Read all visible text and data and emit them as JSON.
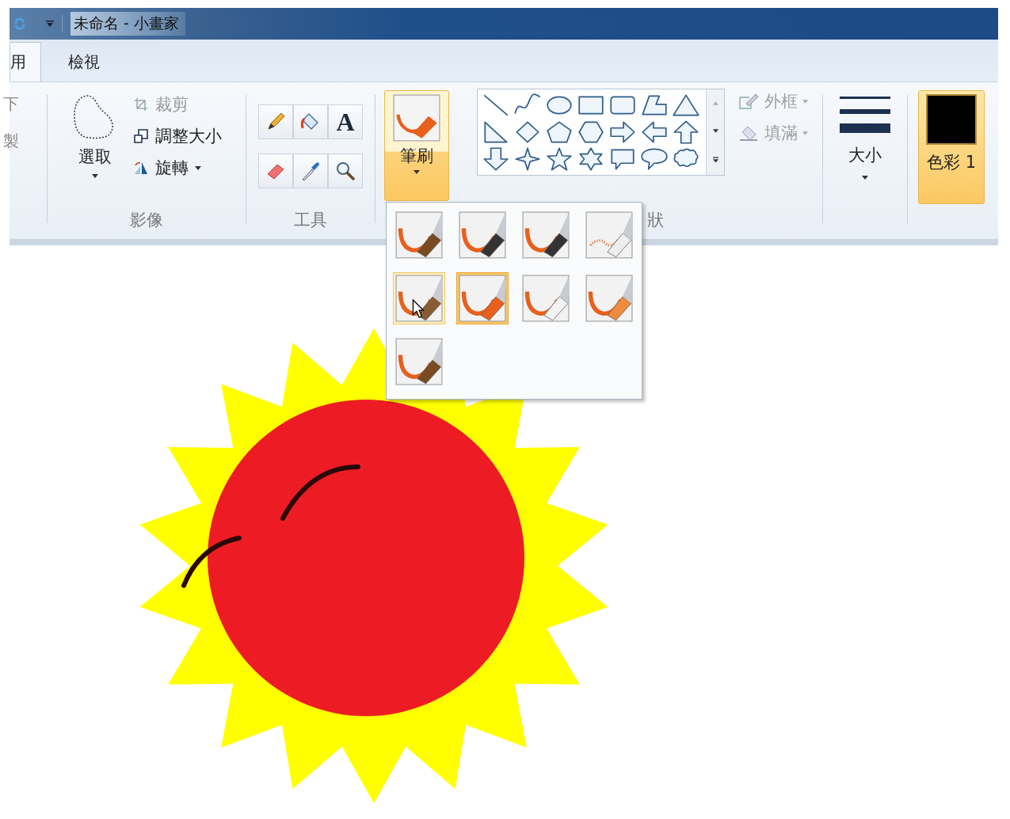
{
  "window": {
    "title": "未命名 - 小畫家"
  },
  "tabs": [
    {
      "label": "用",
      "selected": true
    },
    {
      "label": "檢視",
      "selected": false
    }
  ],
  "clipboard": {
    "items": [
      "下",
      "製"
    ]
  },
  "image": {
    "select_label": "選取",
    "group_label": "影像",
    "commands": [
      {
        "kind": "crop",
        "label": "裁剪",
        "disabled": true,
        "dropdown": false
      },
      {
        "kind": "resize",
        "label": "調整大小",
        "disabled": false,
        "dropdown": false
      },
      {
        "kind": "rotate",
        "label": "旋轉",
        "disabled": false,
        "dropdown": true
      }
    ]
  },
  "tools": {
    "group_label": "工具",
    "items": [
      {
        "kind": "pencil"
      },
      {
        "kind": "fill"
      },
      {
        "kind": "text",
        "glyph": "A"
      },
      {
        "kind": "eraser"
      },
      {
        "kind": "picker"
      },
      {
        "kind": "magnifier"
      }
    ]
  },
  "brushes": {
    "label": "筆刷",
    "open": true
  },
  "shapes": {
    "group_label": "狀",
    "outline": {
      "label": "外框",
      "disabled": true
    },
    "fill": {
      "label": "填滿",
      "disabled": true
    },
    "items": [
      {
        "kind": "line"
      },
      {
        "kind": "curve"
      },
      {
        "kind": "oval"
      },
      {
        "kind": "rect"
      },
      {
        "kind": "roundrect"
      },
      {
        "kind": "polygon"
      },
      {
        "kind": "triangle"
      },
      {
        "kind": "rtriangle"
      },
      {
        "kind": "diamond"
      },
      {
        "kind": "pentagon"
      },
      {
        "kind": "hexagon"
      },
      {
        "kind": "rarrow"
      },
      {
        "kind": "larrow"
      },
      {
        "kind": "uarrow"
      },
      {
        "kind": "darrow"
      },
      {
        "kind": "star4"
      },
      {
        "kind": "star5"
      },
      {
        "kind": "star6"
      },
      {
        "kind": "callrect"
      },
      {
        "kind": "calloval"
      },
      {
        "kind": "callcloud"
      }
    ]
  },
  "size": {
    "label": "大小"
  },
  "color1": {
    "label": "色彩 1",
    "selected": true
  },
  "brush_menu": {
    "items": [
      {
        "kind": "brush",
        "selected": false,
        "hover": false
      },
      {
        "kind": "calligraphy",
        "selected": false,
        "hover": false
      },
      {
        "kind": "calligraphy2",
        "selected": false,
        "hover": false
      },
      {
        "kind": "airbrush",
        "selected": false,
        "hover": false
      },
      {
        "kind": "oil",
        "selected": false,
        "hover": true
      },
      {
        "kind": "crayon",
        "selected": true,
        "hover": false
      },
      {
        "kind": "marker",
        "selected": false,
        "hover": false
      },
      {
        "kind": "pencil",
        "selected": false,
        "hover": false
      },
      {
        "kind": "watercolor",
        "selected": false,
        "hover": false
      }
    ]
  }
}
